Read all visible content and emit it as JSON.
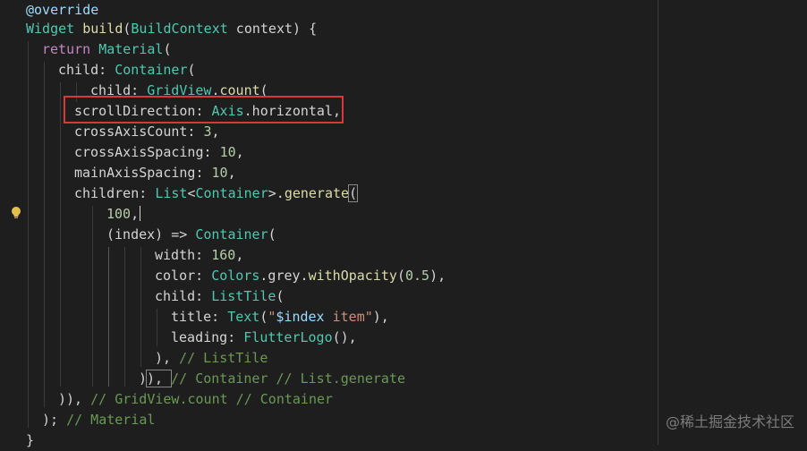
{
  "colors": {
    "background": "#1e1e1e",
    "keyword": "#c586c0",
    "type": "#4ec9b0",
    "function": "#dcdcaa",
    "number": "#b5cea8",
    "string": "#ce9178",
    "comment": "#6a9955",
    "annotation": "#9cdcfe",
    "highlight_box": "#d9383a"
  },
  "icons": {
    "gutter": "lightbulb-icon"
  },
  "code": {
    "l1_annotation": "@override",
    "l2_type": "Widget",
    "l2_fn": "build",
    "l2_open": "(",
    "l2_param_type": "BuildContext",
    "l2_rest": " context) {",
    "l3_kw": "return",
    "l3_type": "Material",
    "l3_rest": "(",
    "l4_prop": "child: ",
    "l4_type": "Container",
    "l4_rest": "(",
    "l5_prop": "child: ",
    "l5_type": "GridView",
    "l5_dot": ".",
    "l5_fn": "count",
    "l5_rest": "(",
    "l6_prop": "scrollDirection: ",
    "l6_type": "Axis",
    "l6_rest": ".horizontal,",
    "l7_prop": "crossAxisCount: ",
    "l7_num": "3",
    "l7_rest": ",",
    "l8_prop": "crossAxisSpacing: ",
    "l8_num": "10",
    "l8_rest": ",",
    "l9_prop": "mainAxisSpacing: ",
    "l9_num": "10",
    "l9_rest": ",",
    "l10_prop": "children: ",
    "l10_type1": "List",
    "l10_lt": "<",
    "l10_type2": "Container",
    "l10_gt": ">.",
    "l10_fn": "generate",
    "l10_rest": "(",
    "l11_num": "100",
    "l11_rest": ",",
    "l12_start": "(index) => ",
    "l12_type": "Container",
    "l12_rest": "(",
    "l13_prop": "width: ",
    "l13_num": "160",
    "l13_rest": ",",
    "l14_prop": "color: ",
    "l14_type": "Colors",
    "l14_mid": ".grey.",
    "l14_fn": "withOpacity",
    "l14_open": "(",
    "l14_num": "0.5",
    "l14_rest": "),",
    "l15_prop": "child: ",
    "l15_type": "ListTile",
    "l15_rest": "(",
    "l16_prop": "title: ",
    "l16_type": "Text",
    "l16_open": "(",
    "l16_str1": "\"",
    "l16_interp": "$index",
    "l16_str2": " item\"",
    "l16_rest": "),",
    "l17_prop": "leading: ",
    "l17_type": "FlutterLogo",
    "l17_rest": "(),",
    "l18_code": "), ",
    "l18_comment": "// ListTile",
    "l19_code1": ")",
    "l19_code2": "), ",
    "l19_comment": "// Container // List.generate",
    "l20_code": ")), ",
    "l20_comment": "// GridView.count // Container",
    "l21_code": "); ",
    "l21_comment": "// Material",
    "l22_code": "}"
  },
  "watermark": "@稀土掘金技术社区"
}
